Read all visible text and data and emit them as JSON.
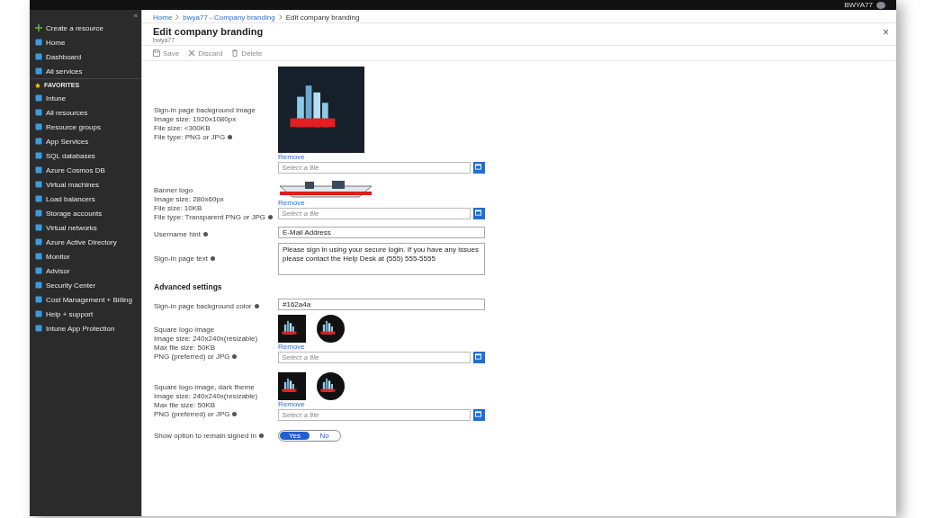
{
  "top_bar": {
    "user_name": "BWYA77"
  },
  "sidebar": {
    "collapse_icon": "«",
    "items": [
      {
        "label": "Create a resource",
        "kind": "create"
      },
      {
        "label": "Home",
        "kind": "item"
      },
      {
        "label": "Dashboard",
        "kind": "item"
      },
      {
        "label": "All services",
        "kind": "item"
      },
      {
        "label": "FAVORITES",
        "kind": "section"
      },
      {
        "label": "Intune",
        "kind": "item"
      },
      {
        "label": "All resources",
        "kind": "item"
      },
      {
        "label": "Resource groups",
        "kind": "item"
      },
      {
        "label": "App Services",
        "kind": "item"
      },
      {
        "label": "SQL databases",
        "kind": "item"
      },
      {
        "label": "Azure Cosmos DB",
        "kind": "item"
      },
      {
        "label": "Virtual machines",
        "kind": "item"
      },
      {
        "label": "Load balancers",
        "kind": "item"
      },
      {
        "label": "Storage accounts",
        "kind": "item"
      },
      {
        "label": "Virtual networks",
        "kind": "item"
      },
      {
        "label": "Azure Active Directory",
        "kind": "item"
      },
      {
        "label": "Monitor",
        "kind": "item"
      },
      {
        "label": "Advisor",
        "kind": "item"
      },
      {
        "label": "Security Center",
        "kind": "item"
      },
      {
        "label": "Cost Management + Billing",
        "kind": "item"
      },
      {
        "label": "Help + support",
        "kind": "item"
      },
      {
        "label": "Intune App Protection",
        "kind": "item"
      }
    ]
  },
  "breadcrumb": [
    {
      "label": "Home",
      "link": true
    },
    {
      "label": "bwya77 - Company branding",
      "link": true
    },
    {
      "label": "Edit company branding",
      "link": false
    }
  ],
  "blade": {
    "title": "Edit company branding",
    "subtitle": "bwya77",
    "close": "×"
  },
  "toolbar": [
    {
      "label": "Save",
      "disabled": true
    },
    {
      "label": "Discard",
      "disabled": true
    },
    {
      "label": "Delete",
      "disabled": true
    }
  ],
  "fields": [
    {
      "kind": "background_image",
      "label_lines": [
        "Sign-in page background image",
        "Image size: 1920x1080px",
        "File size: <300KB",
        "File type: PNG or JPG"
      ],
      "remove": "Remove",
      "placeholder": "Select a file"
    },
    {
      "kind": "banner_image",
      "label_lines": [
        "Banner logo",
        "Image size: 280x60px",
        "File size: 10KB",
        "File type: Transparent PNG or JPG"
      ],
      "remove": "Remove",
      "placeholder": "Select a file"
    },
    {
      "kind": "text",
      "label_lines": [
        "Username hint"
      ],
      "value": "E-Mail Address"
    },
    {
      "kind": "textarea",
      "label_lines": [
        "Sign-in page text"
      ],
      "value": "Please sign in using your secure login. If you have any issues please contact the Help Desk at (555) 555-5555"
    },
    {
      "kind": "heading",
      "label_lines": [
        "Advanced settings"
      ]
    },
    {
      "kind": "text",
      "label_lines": [
        "Sign-in page background color"
      ],
      "value": "#162a4a"
    },
    {
      "kind": "square_image",
      "label_lines": [
        "Square logo image",
        "Image size: 240x240x(resizable)",
        "Max file size: 50KB",
        "PNG (preferred) or JPG"
      ],
      "remove": "Remove",
      "placeholder": "Select a file"
    },
    {
      "kind": "square_image",
      "label_lines": [
        "Square logo image, dark theme",
        "Image size: 240x240x(resizable)",
        "Max file size: 50KB",
        "PNG (preferred) or JPG"
      ],
      "remove": "Remove",
      "placeholder": "Select a file"
    },
    {
      "kind": "toggle",
      "label_lines": [
        "Show option to remain signed in"
      ],
      "options": [
        {
          "label": "Yes",
          "selected": true
        },
        {
          "label": "No",
          "selected": false
        }
      ]
    }
  ]
}
